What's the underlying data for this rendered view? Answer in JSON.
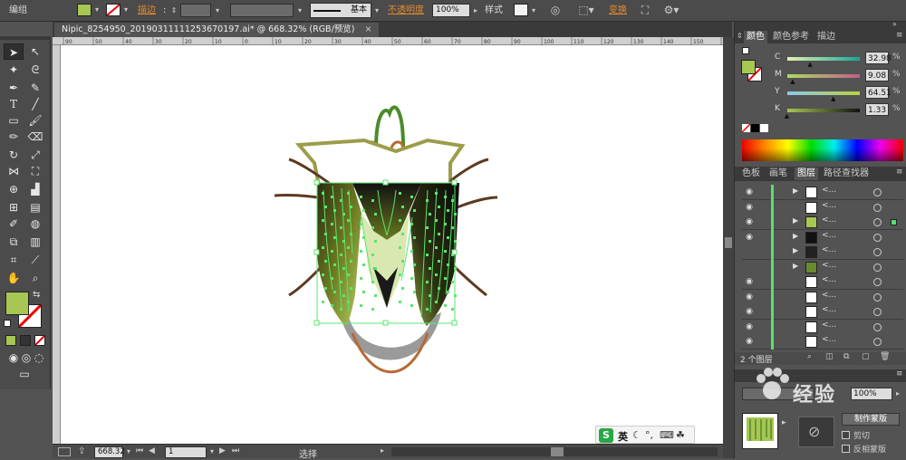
{
  "control_bar": {
    "mode_label": "编组",
    "stroke_label": "描边",
    "stroke_style_label": "基本",
    "opacity_label": "不透明度",
    "opacity_value": "100%",
    "style_label": "样式",
    "transform_label": "变换",
    "fill_color": "#a7c653"
  },
  "document": {
    "tab_title": "Nipic_8254950_20190311111253670197.ai* @ 668.32% (RGB/预览)",
    "ruler_marks": [
      "90",
      "50",
      "40",
      "30",
      "20",
      "10",
      "0",
      "10",
      "20",
      "30",
      "40",
      "50",
      "60",
      "70",
      "80",
      "90",
      "100",
      "110",
      "120",
      "130",
      "140",
      "150",
      "160"
    ]
  },
  "status_bar": {
    "zoom": "668.32",
    "page": "1",
    "tool_name": "选择"
  },
  "ime_bar": {
    "mode": "英"
  },
  "color_panel": {
    "tabs": [
      "颜色",
      "颜色参考",
      "描边"
    ],
    "fill_color": "#a7c653",
    "channels": [
      {
        "name": "C",
        "value": "32.98",
        "pos": 0.33
      },
      {
        "name": "M",
        "value": "9.08",
        "pos": 0.09
      },
      {
        "name": "Y",
        "value": "64.51",
        "pos": 0.65
      },
      {
        "name": "K",
        "value": "1.33",
        "pos": 0.01
      }
    ]
  },
  "layers_panel": {
    "tabs": [
      "色板",
      "画笔",
      "图层",
      "路径查找器"
    ],
    "layer_count_label": "2 个图层",
    "rows": [
      {
        "visible": true,
        "name": "<..."
      },
      {
        "visible": true,
        "name": "<..."
      },
      {
        "visible": true,
        "name": "<..."
      },
      {
        "visible": true,
        "name": "<..."
      },
      {
        "visible": false,
        "name": "<..."
      },
      {
        "visible": false,
        "name": "<..."
      },
      {
        "visible": true,
        "name": "<..."
      },
      {
        "visible": true,
        "name": "<..."
      },
      {
        "visible": true,
        "name": "<..."
      },
      {
        "visible": true,
        "name": "<..."
      },
      {
        "visible": true,
        "name": "<..."
      }
    ]
  },
  "transparency_panel": {
    "opacity_value": "100%",
    "make_mask_label": "制作蒙版",
    "clip_label": "剪切",
    "invert_mask_label": "反相蒙版"
  },
  "watermark": {
    "text": "经验"
  }
}
